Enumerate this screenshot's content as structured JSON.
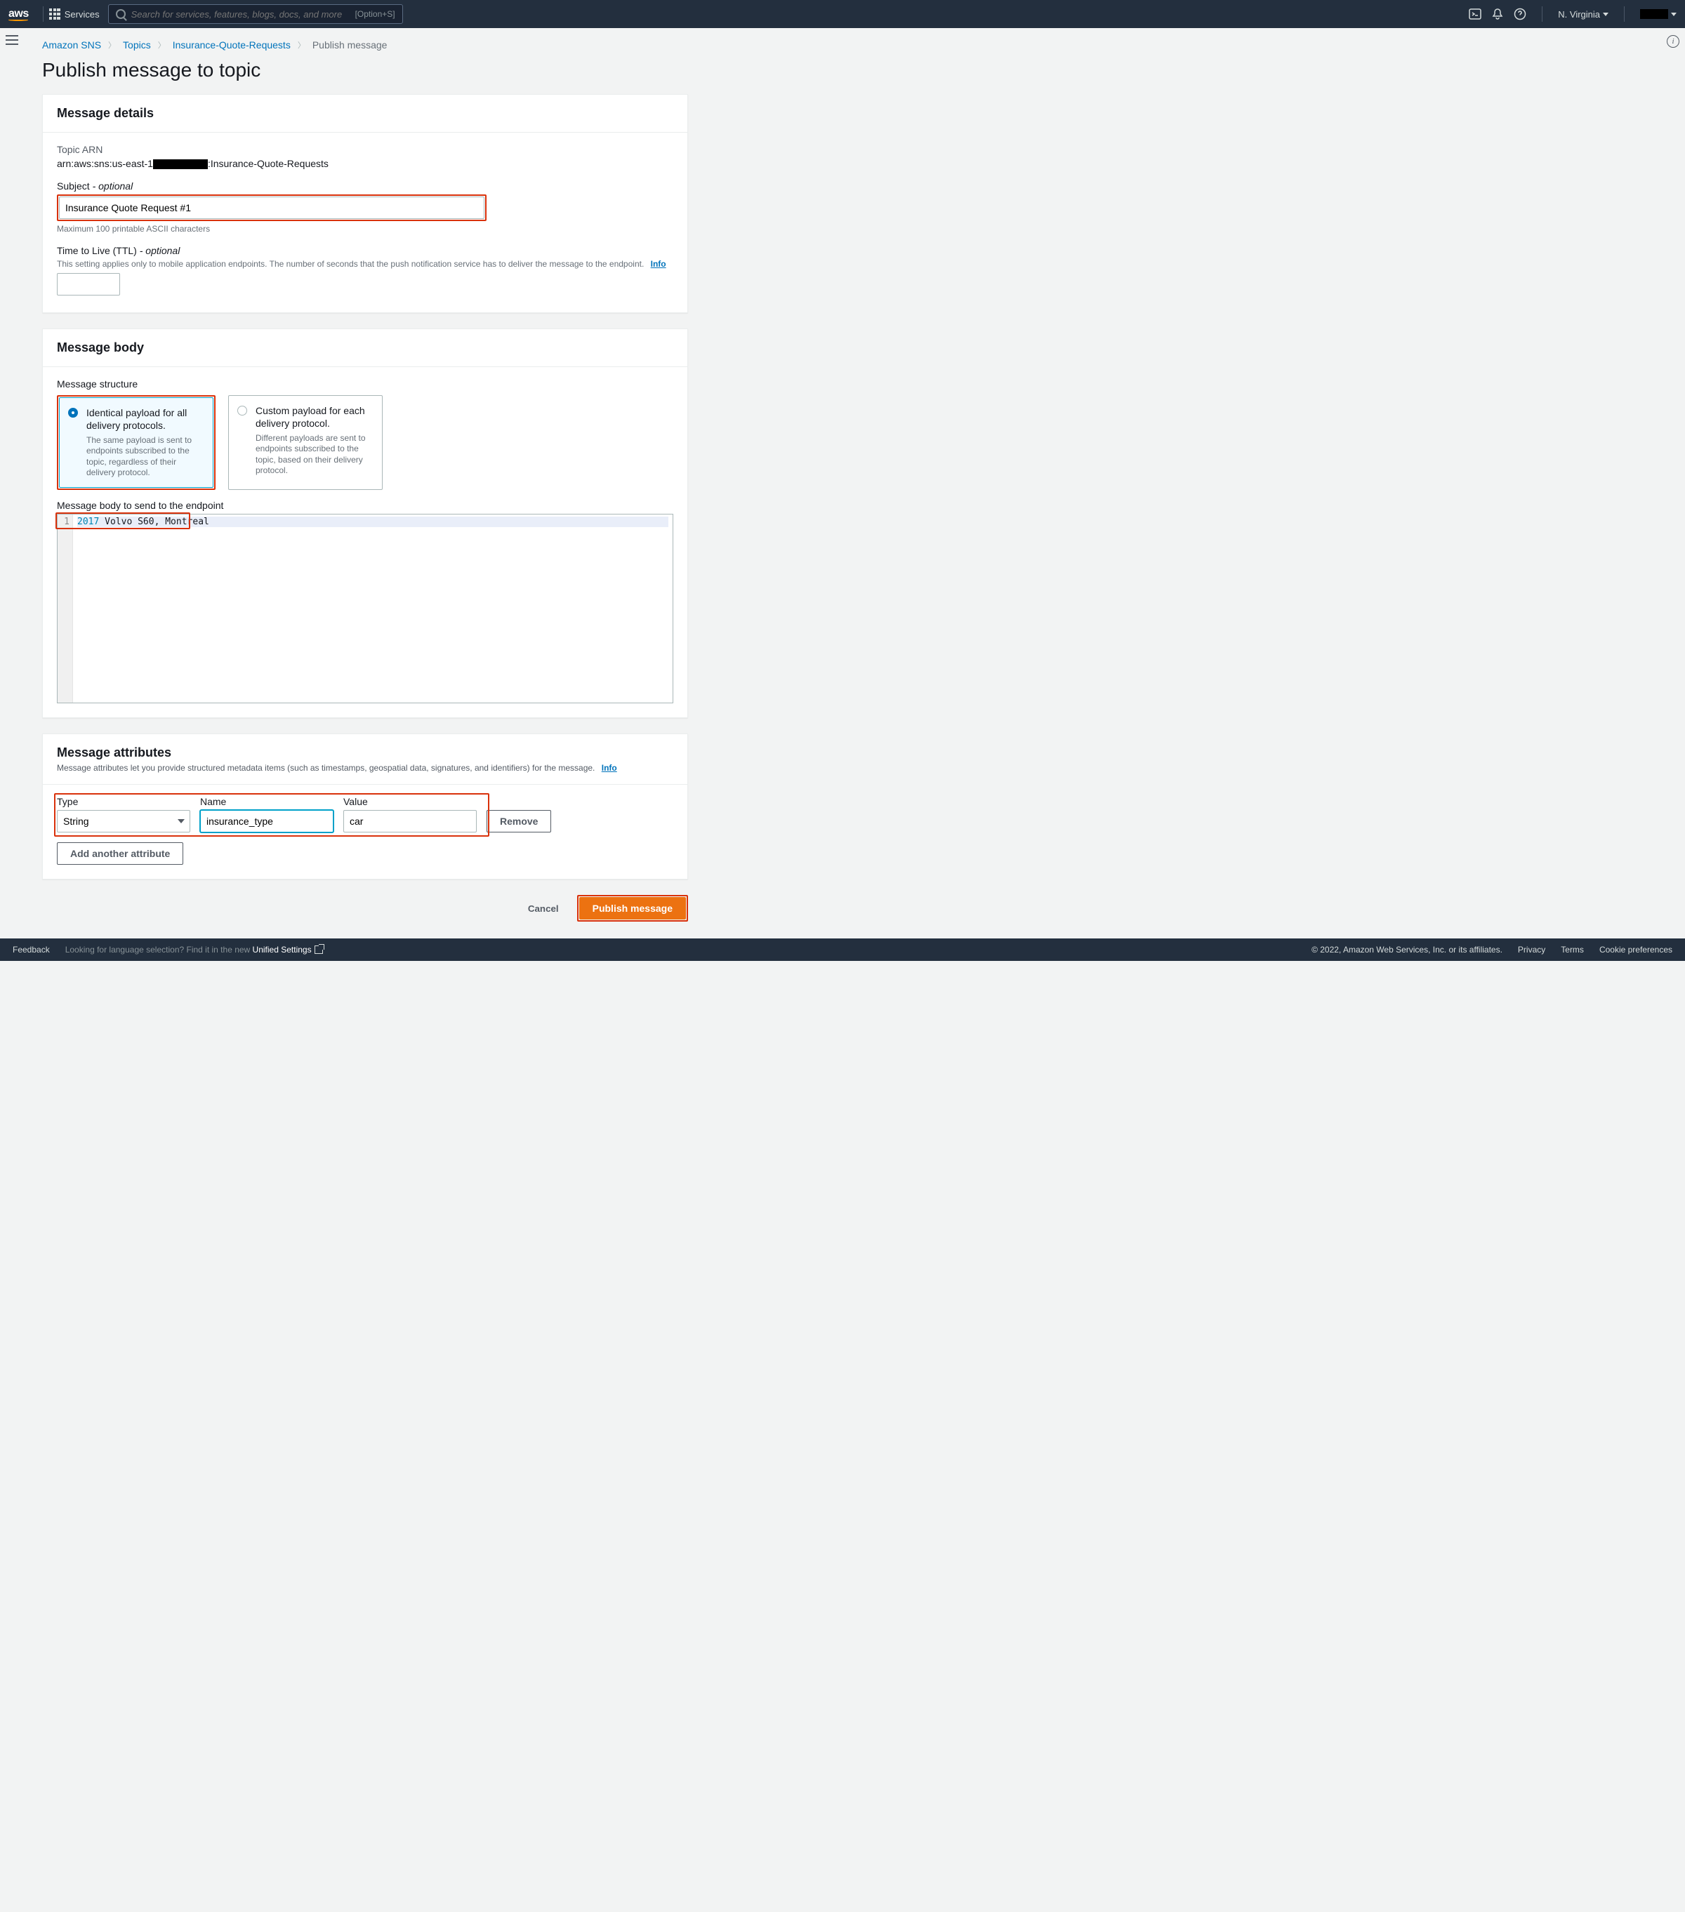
{
  "topnav": {
    "services_label": "Services",
    "search_placeholder": "Search for services, features, blogs, docs, and more",
    "search_shortcut": "[Option+S]",
    "region": "N. Virginia"
  },
  "breadcrumb": {
    "items": [
      "Amazon SNS",
      "Topics",
      "Insurance-Quote-Requests"
    ],
    "current": "Publish message"
  },
  "page_title": "Publish message to topic",
  "details": {
    "title": "Message details",
    "arn_label": "Topic ARN",
    "arn_prefix": "arn:aws:sns:us-east-1",
    "arn_suffix": ":Insurance-Quote-Requests",
    "subject_label": "Subject",
    "subject_optional": " - optional",
    "subject_value": "Insurance Quote Request #1",
    "subject_hint": "Maximum 100 printable ASCII characters",
    "ttl_label": "Time to Live (TTL)",
    "ttl_optional": " - optional",
    "ttl_hint": "This setting applies only to mobile application endpoints. The number of seconds that the push notification service has to deliver the message to the endpoint.",
    "info": "Info"
  },
  "body": {
    "title": "Message body",
    "structure_label": "Message structure",
    "options": [
      {
        "title": "Identical payload for all delivery protocols.",
        "desc": "The same payload is sent to endpoints subscribed to the topic, regardless of their delivery protocol."
      },
      {
        "title": "Custom payload for each delivery protocol.",
        "desc": "Different payloads are sent to endpoints subscribed to the topic, based on their delivery protocol."
      }
    ],
    "editor_label": "Message body to send to the endpoint",
    "line_no": "1",
    "code_year": "2017",
    "code_rest": " Volvo S60, Montreal"
  },
  "attrs": {
    "title": "Message attributes",
    "desc": "Message attributes let you provide structured metadata items (such as timestamps, geospatial data, signatures, and identifiers) for the message.",
    "info": "Info",
    "type_label": "Type",
    "name_label": "Name",
    "value_label": "Value",
    "type_value": "String",
    "name_value": "insurance_type",
    "value_value": "car",
    "remove": "Remove",
    "add": "Add another attribute"
  },
  "actions": {
    "cancel": "Cancel",
    "publish": "Publish message"
  },
  "footer": {
    "feedback": "Feedback",
    "lang_prefix": "Looking for language selection? Find it in the new ",
    "lang_link": "Unified Settings",
    "copyright": "© 2022, Amazon Web Services, Inc. or its affiliates.",
    "privacy": "Privacy",
    "terms": "Terms",
    "cookies": "Cookie preferences"
  }
}
